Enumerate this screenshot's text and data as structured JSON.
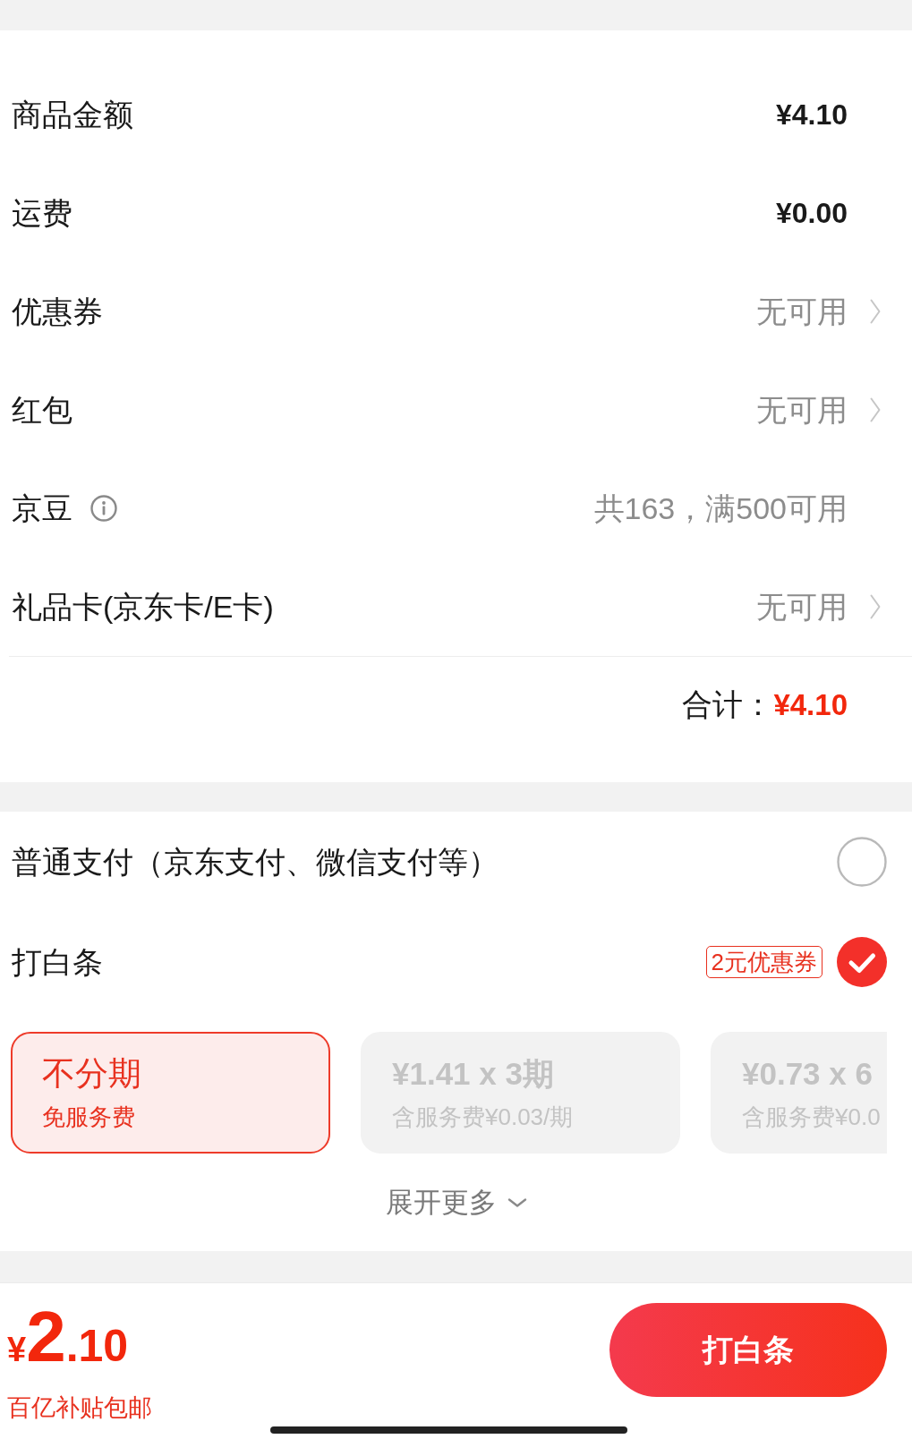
{
  "summary_rows": [
    {
      "kind": "amount",
      "label": "商品金额",
      "value": "¥4.10"
    },
    {
      "kind": "amount",
      "label": "运费",
      "value": "¥0.00"
    },
    {
      "kind": "link",
      "label": "优惠券",
      "value": "无可用"
    },
    {
      "kind": "link",
      "label": "红包",
      "value": "无可用"
    },
    {
      "kind": "info",
      "label": "京豆",
      "value": "共163，满500可用"
    },
    {
      "kind": "link",
      "label": "礼品卡(京东卡/E卡)",
      "value": "无可用"
    }
  ],
  "total": {
    "label": "合计：",
    "value": "¥4.10"
  },
  "payment_methods": [
    {
      "label": "普通支付（京东支付、微信支付等）",
      "selected": false
    },
    {
      "label": "打白条",
      "badge": "2元优惠券",
      "selected": true
    }
  ],
  "installment_plans": [
    {
      "title": "不分期",
      "subtitle": "免服务费",
      "selected": true
    },
    {
      "title": "¥1.41 x 3期",
      "subtitle": "含服务费¥0.03/期",
      "selected": false
    },
    {
      "title": "¥0.73 x 6",
      "subtitle": "含服务费¥0.0",
      "selected": false
    }
  ],
  "expand_button": {
    "label": "展开更多"
  },
  "footer": {
    "price": {
      "symbol": "¥",
      "integer": "2",
      "decimal": ".10"
    },
    "note": "百亿补贴包邮",
    "button": "打白条"
  }
}
